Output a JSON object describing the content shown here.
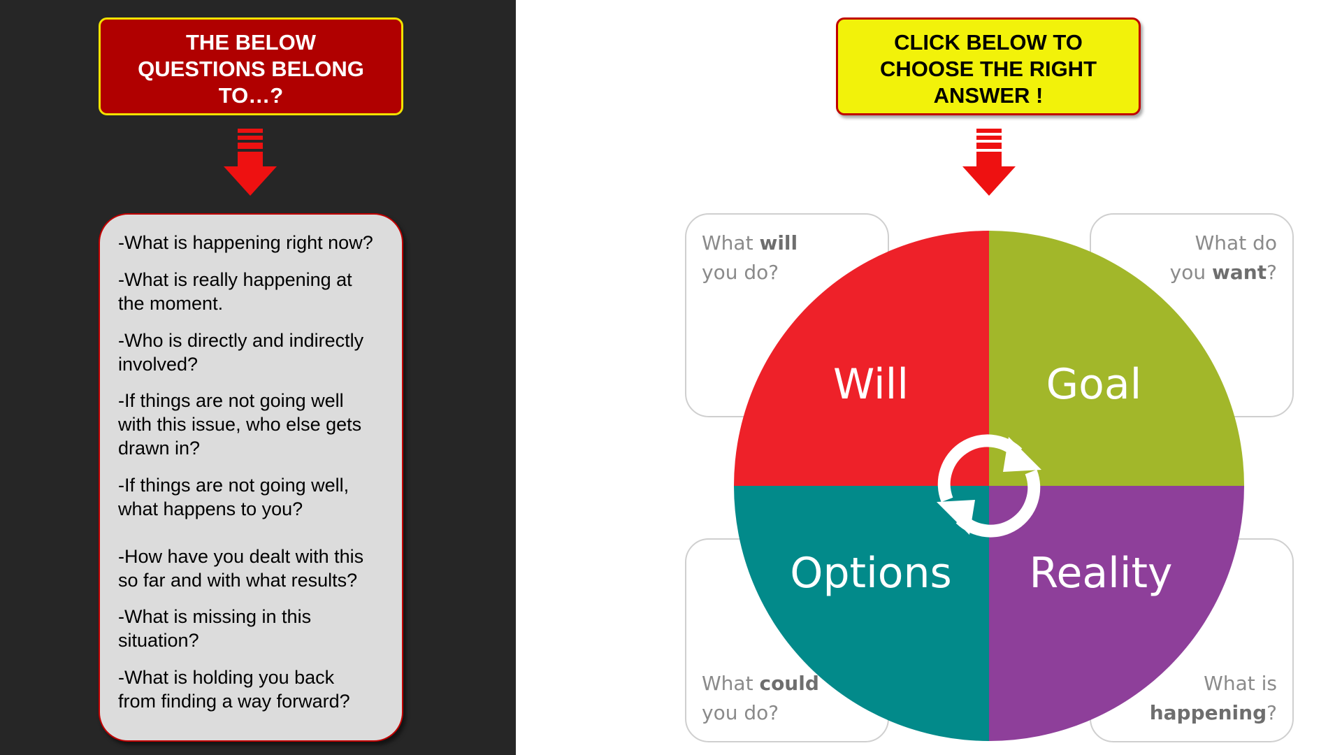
{
  "left": {
    "callout": {
      "line1": "THE BELOW",
      "line2": "QUESTIONS BELONG",
      "line3": "TO…?"
    },
    "questions": [
      [
        "-What is happening right now?"
      ],
      [
        "-What is really happening at",
        "the moment."
      ],
      [
        "-Who is directly and indirectly",
        "involved?"
      ],
      [
        "-If things are not going well",
        "with this issue, who else gets",
        "drawn in?"
      ],
      [
        "-If things are not going well,",
        "what happens to you?"
      ],
      [
        "-How have you dealt with this",
        "so far and with what results?"
      ],
      [
        "-What is missing in this",
        "situation?"
      ],
      [
        "-What is holding you back",
        "from finding a way forward?"
      ]
    ]
  },
  "right": {
    "callout": {
      "line1": "CLICK BELOW TO",
      "line2": "CHOOSE THE RIGHT",
      "line3": "ANSWER !"
    },
    "wheel": {
      "will": "Will",
      "goal": "Goal",
      "options": "Options",
      "reality": "Reality"
    },
    "cards": {
      "will": {
        "pre": "What ",
        "bold": "will",
        "line2": "you do?"
      },
      "goal": {
        "line1": "What do",
        "pre": "you ",
        "bold": "want",
        "post": "?"
      },
      "options": {
        "pre": "What ",
        "bold": "could",
        "line2": "you do?"
      },
      "reality": {
        "line1": "What is",
        "bold": "happening",
        "post": "?"
      }
    }
  },
  "colors": {
    "dark_panel": "#262626",
    "left_callout": "#b00000",
    "callout_border_yellow": "#f2e200",
    "right_callout": "#f2f20a",
    "arrow_red": "#ee1111",
    "will": "#ee2129",
    "goal": "#a2b72a",
    "options": "#028a8a",
    "reality": "#8e3f9a"
  },
  "icons": [
    "down-arrow-icon",
    "cycle-arrows-icon"
  ]
}
